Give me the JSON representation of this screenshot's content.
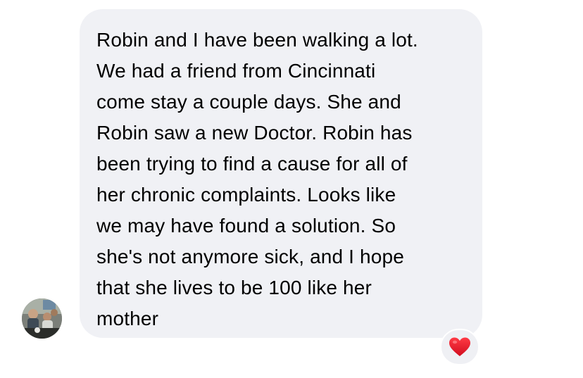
{
  "message": {
    "text": "Robin and I have been walking a lot.\nWe had a friend from Cincinnati\ncome stay a couple days. She and\nRobin saw a new Doctor. Robin has\nbeen trying to find a cause for all of\nher chronic complaints. Looks like\nwe may have found a solution. So\nshe's not anymore sick, and I hope\nthat she lives to be 100 like her\nmother"
  },
  "reaction": {
    "icon": "red-heart-icon",
    "color": "#e8162b"
  },
  "colors": {
    "bubble_background": "#f0f1f5",
    "text": "#000000"
  }
}
